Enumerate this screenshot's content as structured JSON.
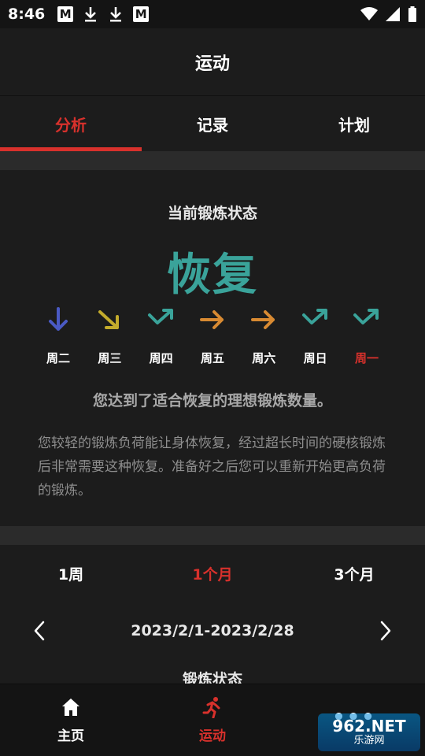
{
  "status_bar": {
    "time": "8:46",
    "m_label": "M"
  },
  "header": {
    "title": "运动"
  },
  "tabs": [
    {
      "label": "分析",
      "active": true
    },
    {
      "label": "记录",
      "active": false
    },
    {
      "label": "计划",
      "active": false
    }
  ],
  "status_card": {
    "label": "当前锻炼状态",
    "value": "恢复",
    "days": [
      {
        "label": "周二",
        "icon": "arrow-down-icon",
        "color": "#4a5ac4",
        "today": false
      },
      {
        "label": "周三",
        "icon": "arrow-down-right-icon",
        "color": "#c4ac2c",
        "today": false
      },
      {
        "label": "周四",
        "icon": "arrow-check-up-icon",
        "color": "#3aa39a",
        "today": false
      },
      {
        "label": "周五",
        "icon": "arrow-right-icon",
        "color": "#d88a32",
        "today": false
      },
      {
        "label": "周六",
        "icon": "arrow-right-icon",
        "color": "#d88a32",
        "today": false
      },
      {
        "label": "周日",
        "icon": "arrow-check-up-icon",
        "color": "#3aa39a",
        "today": false
      },
      {
        "label": "周一",
        "icon": "arrow-check-up-icon",
        "color": "#3aa39a",
        "today": true
      }
    ],
    "summary": "您达到了适合恢复的理想锻炼数量。",
    "description": "您较轻的锻炼负荷能让身体恢复，经过超长时间的硬核锻炼后非常需要这种恢复。准备好之后您可以重新开始更高负荷的锻炼。"
  },
  "range": {
    "tabs": [
      {
        "label": "1周",
        "active": false
      },
      {
        "label": "1个月",
        "active": true
      },
      {
        "label": "3个月",
        "active": false
      }
    ],
    "date_range": "2023/2/1-2023/2/28"
  },
  "section_peek": "锻炼状态",
  "bottom_nav": [
    {
      "label": "主页",
      "icon": "home-icon",
      "active": false
    },
    {
      "label": "运动",
      "icon": "running-icon",
      "active": true
    },
    {
      "label": "",
      "icon": "more-icon",
      "active": false
    }
  ],
  "watermark": {
    "top": "962.NET",
    "bottom": "乐游网"
  },
  "colors": {
    "accent": "#d8312c",
    "recovery": "#3aa39a"
  }
}
